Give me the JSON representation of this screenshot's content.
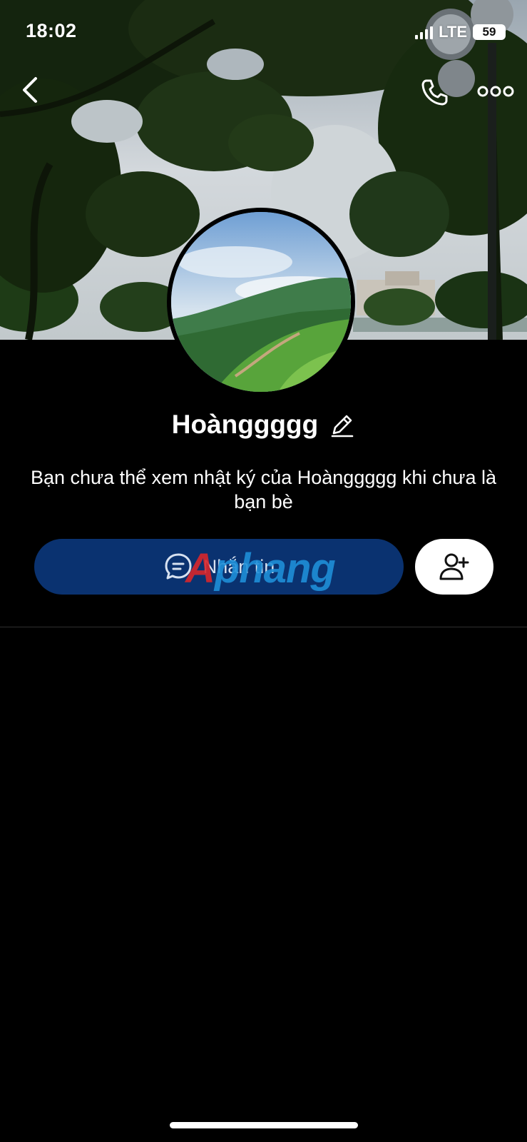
{
  "status_bar": {
    "time": "18:02",
    "network": "LTE",
    "battery": "59"
  },
  "nav": {
    "back_icon": "chevron-left-icon",
    "call_icon": "phone-icon",
    "more_icon": "more-horizontal-icon"
  },
  "profile": {
    "name": "Hoànggggg",
    "edit_icon": "pencil-icon",
    "notice": "Bạn chưa thể xem nhật ký của Hoànggggg khi chưa là bạn bè"
  },
  "actions": {
    "message_label": "Nhắn tin",
    "message_icon": "chat-bubble-icon",
    "add_friend_icon": "add-user-icon"
  },
  "watermark": {
    "part1": "A",
    "part2": "phang"
  },
  "colors": {
    "background": "#000000",
    "message_button": "#0a3270",
    "add_friend_button": "#ffffff"
  }
}
